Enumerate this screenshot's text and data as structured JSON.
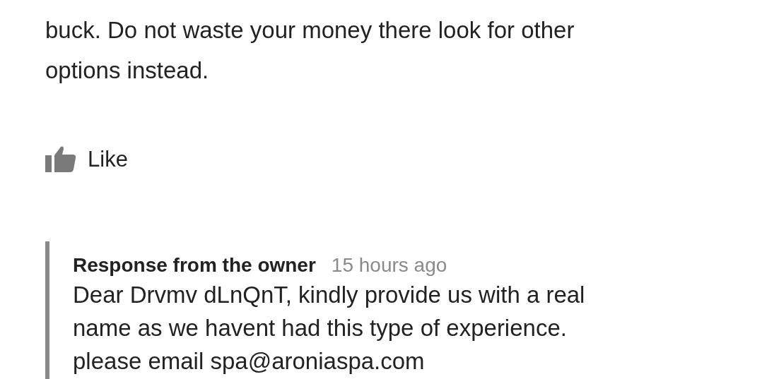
{
  "review": {
    "text": "buck. Do not waste your money there look for other\noptions instead.",
    "like_label": "Like"
  },
  "owner_response": {
    "title": "Response from the owner",
    "time": "15 hours ago",
    "text": "Dear Drvmv dLnQnT, kindly provide us with a real\nname as we havent had this type of experience.\nplease email spa@aroniaspa.com"
  }
}
